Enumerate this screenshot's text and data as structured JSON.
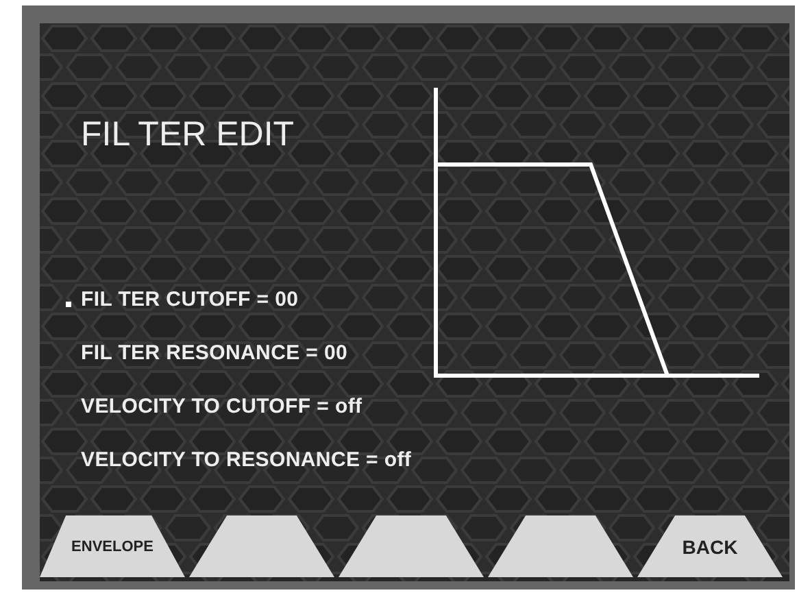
{
  "screen": {
    "title": "FIL TER EDIT"
  },
  "parameters": [
    {
      "label": "FIL TER CUTOFF = 00",
      "selected": true
    },
    {
      "label": "FIL TER RESONANCE = 00",
      "selected": false
    },
    {
      "label": "VELOCITY TO CUTOFF = off",
      "selected": false
    },
    {
      "label": "VELOCITY TO RESONANCE = off",
      "selected": false
    }
  ],
  "soft_keys": [
    {
      "label": "ENVELOPE",
      "kind": "small"
    },
    {
      "kind": "blank"
    },
    {
      "kind": "blank"
    },
    {
      "kind": "blank"
    },
    {
      "label": "BACK",
      "kind": "large"
    }
  ]
}
